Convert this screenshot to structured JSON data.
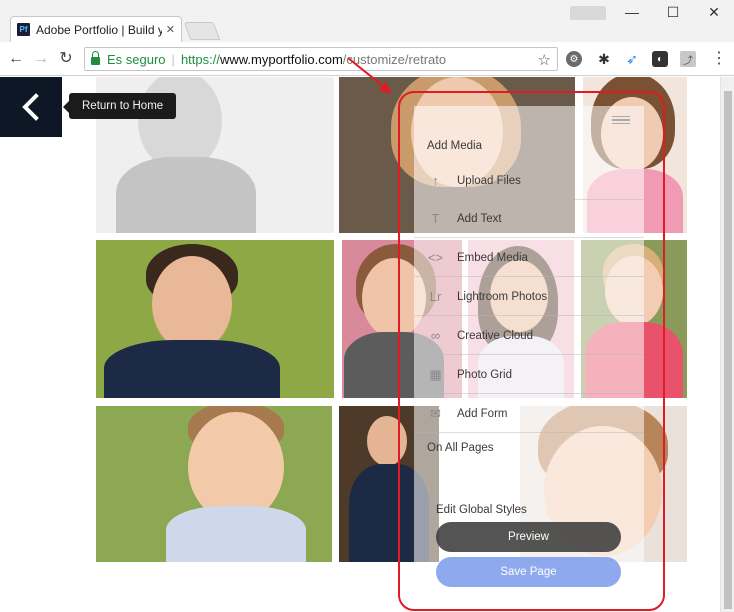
{
  "browser": {
    "tab_title": "Adobe Portfolio | Build yo",
    "favicon_text": "Pf",
    "tab_close": "✕",
    "window_controls": [
      "—",
      "☐",
      "✕"
    ],
    "nav": {
      "back": "←",
      "forward": "→",
      "reload": "↻"
    },
    "address": {
      "secure_label": "Es seguro",
      "separator": "|",
      "scheme": "https://",
      "host": "www.myportfolio.com",
      "path": "/customize/retrato"
    },
    "star": "☆",
    "menu": "⋮"
  },
  "editor": {
    "back_icon": "chevron-left-icon",
    "tooltip": "Return to Home",
    "add_media_heading": "Add Media",
    "menu_items": [
      {
        "label": "Upload Files",
        "icon": "↑"
      },
      {
        "label": "Add Text",
        "icon": "T"
      },
      {
        "label": "Embed Media",
        "icon": "<>"
      },
      {
        "label": "Lightroom Photos",
        "icon": "Lr"
      },
      {
        "label": "Creative Cloud",
        "icon": "∞"
      },
      {
        "label": "Photo Grid",
        "icon": "▦"
      },
      {
        "label": "Add Form",
        "icon": "✉"
      }
    ],
    "on_all_pages_heading": "On All Pages",
    "global_styles": "Edit Global Styles",
    "preview_button": "Preview",
    "save_button": "Save Page"
  },
  "colors": {
    "sidebar_back": "#0e1726",
    "annotation": "#e01b24",
    "secure_green": "#1e8e3e",
    "save_blue": "#82a0eb"
  }
}
